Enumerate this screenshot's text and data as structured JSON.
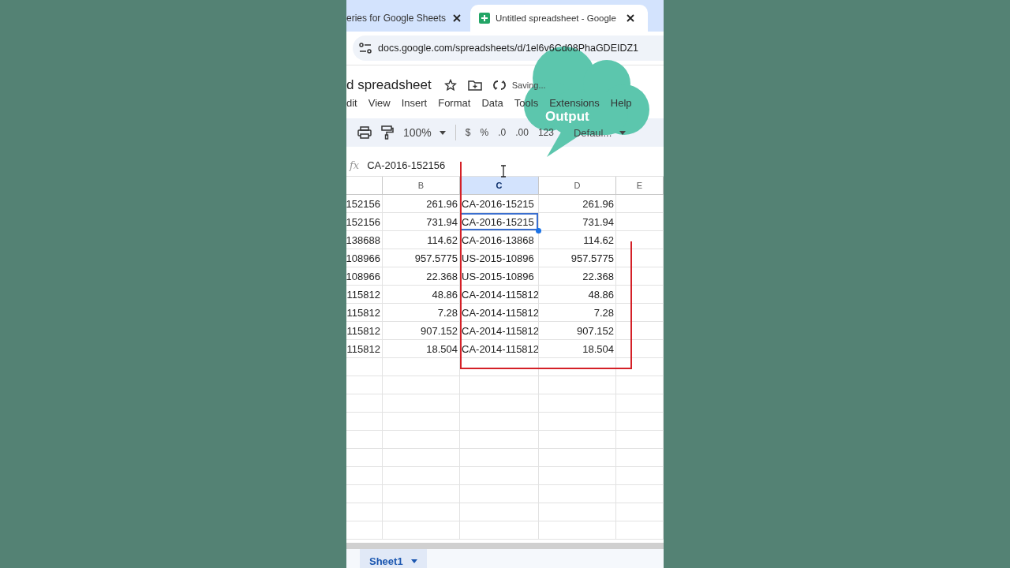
{
  "browser": {
    "tabs": [
      {
        "title": "eries for Google Sheets",
        "selected": false
      },
      {
        "title": "Untitled spreadsheet - Google",
        "selected": true
      }
    ],
    "address": "docs.google.com/spreadsheets/d/1el6v6Cd08PhaGDEIDZ1"
  },
  "document": {
    "title": "d spreadsheet",
    "status": "Saving..."
  },
  "menu": [
    "dit",
    "View",
    "Insert",
    "Format",
    "Data",
    "Tools",
    "Extensions",
    "Help"
  ],
  "toolbar": {
    "zoom": "100%",
    "format_buttons": [
      "$",
      "%",
      ".0",
      ".00",
      "123"
    ],
    "font": "Defaul..."
  },
  "formula_bar": {
    "label": "fx",
    "value": "CA-2016-152156"
  },
  "sheet": {
    "columns": [
      {
        "selected": false
      },
      {
        "label": "B",
        "selected": false
      },
      {
        "label": "C",
        "selected": true
      },
      {
        "label": "D",
        "selected": false
      },
      {
        "label": "E",
        "selected": false
      }
    ],
    "rows": [
      {
        "cells": [
          "152156",
          "261.96",
          "CA-2016-15215",
          "261.96"
        ],
        "selected": false
      },
      {
        "cells": [
          "152156",
          "731.94",
          "CA-2016-15215",
          "731.94"
        ],
        "selected": true
      },
      {
        "cells": [
          "138688",
          "114.62",
          "CA-2016-13868",
          "114.62"
        ],
        "selected": false
      },
      {
        "cells": [
          "108966",
          "957.5775",
          "US-2015-10896",
          "957.5775"
        ],
        "selected": false
      },
      {
        "cells": [
          "108966",
          "22.368",
          "US-2015-10896",
          "22.368"
        ],
        "selected": false
      },
      {
        "cells": [
          "115812",
          "48.86",
          "CA-2014-115812",
          "48.86"
        ],
        "selected": false
      },
      {
        "cells": [
          "115812",
          "7.28",
          "CA-2014-115812",
          "7.28"
        ],
        "selected": false
      },
      {
        "cells": [
          "115812",
          "907.152",
          "CA-2014-115812",
          "907.152"
        ],
        "selected": false
      },
      {
        "cells": [
          "115812",
          "18.504",
          "CA-2014-115812",
          "18.504"
        ],
        "selected": false
      }
    ]
  },
  "sheet_tabs": [
    {
      "label": "Sheet1",
      "selected": true
    }
  ],
  "callout": {
    "text": "Output"
  }
}
